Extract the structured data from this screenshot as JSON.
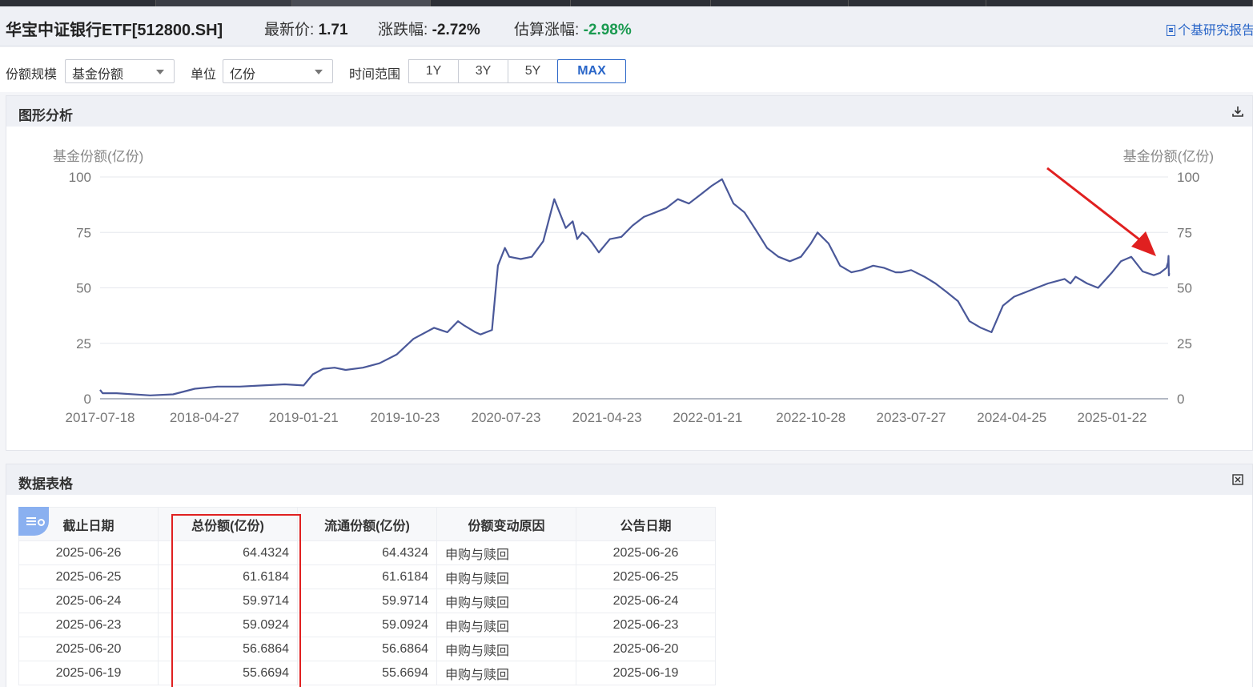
{
  "header": {
    "fund_title": "华宝中证银行ETF[512800.SH]",
    "price_label": "最新价:",
    "price_value": "1.71",
    "change_label": "涨跌幅:",
    "change_value": "-2.72%",
    "est_label": "估算涨幅:",
    "est_value": "-2.98%",
    "report_link": "个基研究报告"
  },
  "controls": {
    "scale_label": "份额规模",
    "scale_value": "基金份额",
    "unit_label": "单位",
    "unit_value": "亿份",
    "range_label": "时间范围",
    "ranges": [
      "1Y",
      "3Y",
      "5Y",
      "MAX"
    ],
    "active_range": "MAX"
  },
  "chart_panel": {
    "title": "图形分析"
  },
  "table_panel": {
    "title": "数据表格"
  },
  "colors": {
    "accent": "#2a66c8",
    "line": "#4a5899",
    "positive": "#1a9a50",
    "highlight": "#e02020"
  },
  "chart_data": {
    "type": "line",
    "ylabel_left": "基金份额(亿份)",
    "ylabel_right": "基金份额(亿份)",
    "ylim": [
      0,
      100
    ],
    "yticks": [
      0,
      25,
      50,
      75,
      100
    ],
    "xticks": [
      "2017-07-18",
      "2018-04-27",
      "2019-01-21",
      "2019-10-23",
      "2020-07-23",
      "2021-04-23",
      "2022-01-21",
      "2022-10-28",
      "2023-07-27",
      "2024-04-25",
      "2025-01-22"
    ],
    "grid": true,
    "series": [
      {
        "x": [
          "2017-07-18",
          "2017-07-25",
          "2017-09-01",
          "2017-12-01",
          "2018-02-01",
          "2018-04-01",
          "2018-06-01",
          "2018-08-01",
          "2018-10-01",
          "2018-12-01",
          "2019-01-21",
          "2019-02-15",
          "2019-03-15",
          "2019-04-15",
          "2019-05-15",
          "2019-07-01",
          "2019-08-15",
          "2019-10-01",
          "2019-11-15",
          "2020-01-10",
          "2020-02-15",
          "2020-03-15",
          "2020-04-01",
          "2020-05-01",
          "2020-05-15",
          "2020-06-15",
          "2020-07-01",
          "2020-07-20",
          "2020-08-01",
          "2020-09-01",
          "2020-10-01",
          "2020-11-01",
          "2020-12-01",
          "2021-01-01",
          "2021-01-20",
          "2021-02-01",
          "2021-02-15",
          "2021-03-01",
          "2021-03-15",
          "2021-04-01",
          "2021-05-01",
          "2021-06-01",
          "2021-07-01",
          "2021-08-01",
          "2021-09-01",
          "2021-10-01",
          "2021-11-01",
          "2021-12-01",
          "2022-01-01",
          "2022-02-01",
          "2022-03-01",
          "2022-04-01",
          "2022-05-01",
          "2022-06-01",
          "2022-07-01",
          "2022-08-01",
          "2022-09-01",
          "2022-10-01",
          "2022-10-28",
          "2022-11-15",
          "2022-12-15",
          "2023-01-15",
          "2023-02-15",
          "2023-03-15",
          "2023-04-15",
          "2023-05-15",
          "2023-06-15",
          "2023-07-01",
          "2023-07-27",
          "2023-09-01",
          "2023-10-01",
          "2023-11-01",
          "2023-12-01",
          "2024-01-01",
          "2024-02-01",
          "2024-03-01",
          "2024-04-01",
          "2024-05-01",
          "2024-06-01",
          "2024-07-01",
          "2024-08-01",
          "2024-09-15",
          "2024-10-01",
          "2024-10-15",
          "2024-11-15",
          "2024-12-15",
          "2025-01-22",
          "2025-02-15",
          "2025-03-15",
          "2025-04-15",
          "2025-05-15",
          "2025-06-01",
          "2025-06-19",
          "2025-06-20",
          "2025-06-23",
          "2025-06-24",
          "2025-06-25",
          "2025-06-26"
        ],
        "values": [
          4,
          2.5,
          2.5,
          1.5,
          2,
          4.5,
          5.5,
          5.5,
          6,
          6.5,
          6,
          11,
          13.5,
          14,
          13,
          14,
          16,
          20,
          27,
          32,
          30,
          35,
          33,
          30,
          29,
          31,
          60,
          68,
          64,
          63,
          64,
          71,
          90,
          77,
          80,
          72,
          75,
          73,
          70,
          66,
          72,
          73,
          78,
          82,
          84,
          86,
          90,
          88,
          92,
          96,
          99,
          88,
          84,
          76,
          68,
          64,
          62,
          64,
          70,
          75,
          70,
          60,
          57,
          58,
          60,
          59,
          57,
          57,
          58,
          55,
          52,
          48,
          44,
          35,
          32,
          30,
          42,
          46,
          48,
          50,
          52,
          54,
          52,
          55,
          52,
          50,
          57,
          62,
          64,
          57.4,
          55.7,
          56.7,
          59.1,
          59.97,
          61.6,
          64.4,
          55.6,
          56.6
        ]
      }
    ]
  },
  "table": {
    "columns": [
      "截止日期",
      "总份额(亿份)",
      "流通份额(亿份)",
      "份额变动原因",
      "公告日期"
    ],
    "rows": [
      [
        "2025-06-26",
        "64.4324",
        "64.4324",
        "申购与赎回",
        "2025-06-26"
      ],
      [
        "2025-06-25",
        "61.6184",
        "61.6184",
        "申购与赎回",
        "2025-06-25"
      ],
      [
        "2025-06-24",
        "59.9714",
        "59.9714",
        "申购与赎回",
        "2025-06-24"
      ],
      [
        "2025-06-23",
        "59.0924",
        "59.0924",
        "申购与赎回",
        "2025-06-23"
      ],
      [
        "2025-06-20",
        "56.6864",
        "56.6864",
        "申购与赎回",
        "2025-06-20"
      ],
      [
        "2025-06-19",
        "55.6694",
        "55.6694",
        "申购与赎回",
        "2025-06-19"
      ]
    ]
  }
}
